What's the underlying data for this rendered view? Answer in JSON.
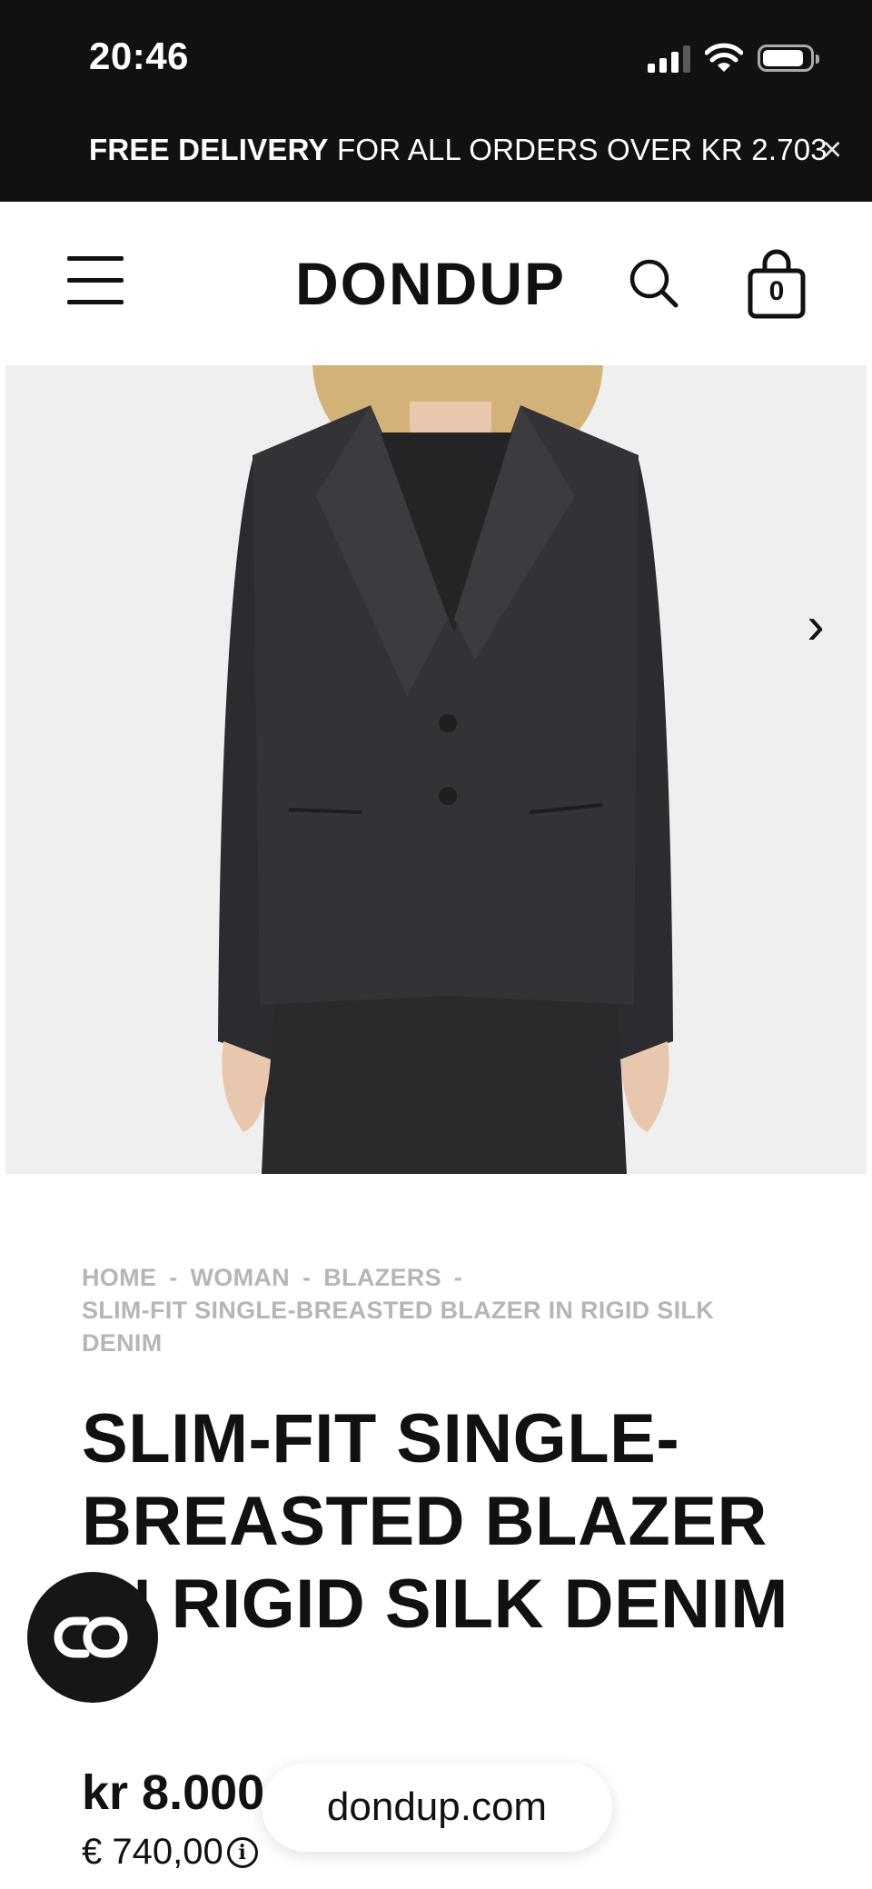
{
  "status_bar": {
    "time": "20:46"
  },
  "promo": {
    "bold": "FREE DELIVERY",
    "text": " FOR ALL ORDERS OVER KR 2.703",
    "close": "×"
  },
  "header": {
    "logo": "DONDUP",
    "cart_count": "0"
  },
  "breadcrumb": {
    "items": [
      "HOME",
      "WOMAN",
      "BLAZERS",
      "SLIM-FIT SINGLE-BREASTED BLAZER IN RIGID SILK DENIM"
    ],
    "separator": "-"
  },
  "product": {
    "title": "SLIM-FIT SINGLE-BREASTED BLAZER IN RIGID SILK DENIM",
    "price": "kr 8.000",
    "price_eur": "€ 740,00",
    "info_glyph": "i"
  },
  "carousel": {
    "next_glyph": "›"
  },
  "browser": {
    "url": "dondup.com"
  },
  "icons": {
    "menu": "menu-icon",
    "search": "search-icon",
    "cart": "shopping-bag-icon",
    "close": "close-icon",
    "next": "chevron-right-icon",
    "chat": "chat-icon",
    "info": "info-icon"
  },
  "colors": {
    "topbar": "#111111",
    "breadcrumb": "#b6b6b6",
    "image_bg": "#efefef",
    "jacket": "#2e2d30"
  }
}
